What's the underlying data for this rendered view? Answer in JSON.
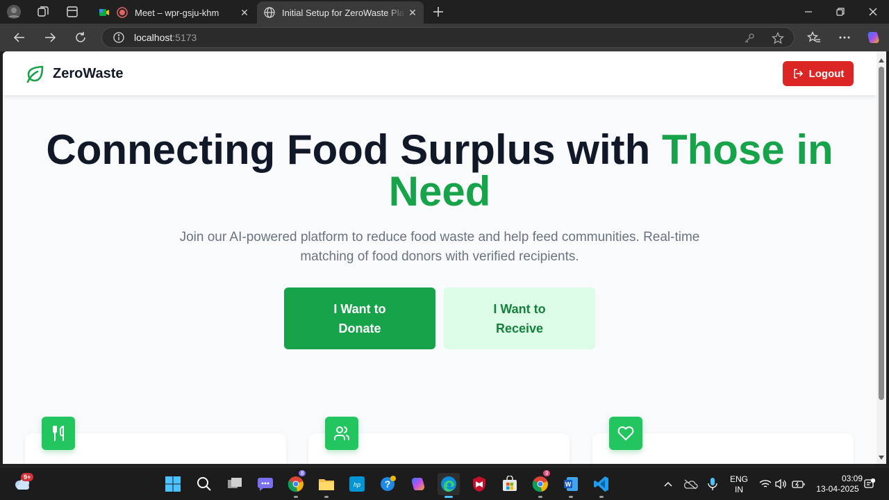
{
  "browser": {
    "tabs": [
      {
        "title": "Meet – wpr-gsju-khm",
        "active": false
      },
      {
        "title": "Initial Setup for ZeroWaste Platfor",
        "active": true
      }
    ],
    "address": {
      "host": "localhost",
      "port": ":5173"
    }
  },
  "page": {
    "brand": "ZeroWaste",
    "logout_label": "Logout",
    "hero": {
      "title_main": "Connecting Food Surplus with ",
      "title_accent": "Those in Need",
      "subtitle": "Join our AI-powered platform to reduce food waste and help feed communities. Real-time matching of food donors with verified recipients."
    },
    "cta": {
      "donate_label": "I Want to Donate",
      "receive_label": "I Want to Receive"
    },
    "feature_icons": [
      "utensils-icon",
      "users-icon",
      "heart-icon"
    ]
  },
  "taskbar": {
    "weather_badge": "9+",
    "chrome_badge": "8",
    "chrome2_badge": "9",
    "lang_top": "ENG",
    "lang_bottom": "IN",
    "time": "03:09",
    "date": "13-04-2025"
  },
  "colors": {
    "brand_green": "#16a34a",
    "light_green": "#dcfce7",
    "logout_red": "#dc2626",
    "heading": "#111827",
    "muted": "#6b7280"
  }
}
